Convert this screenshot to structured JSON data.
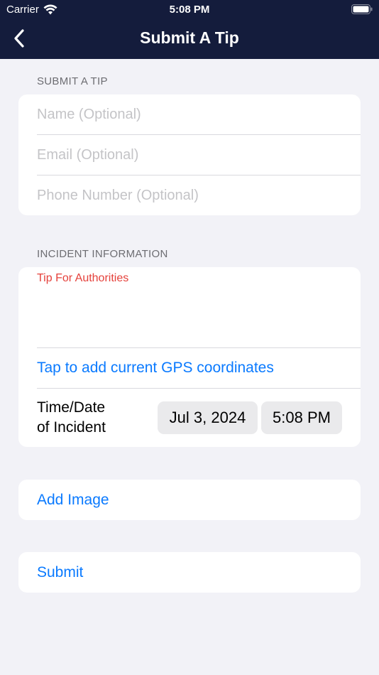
{
  "status_bar": {
    "carrier": "Carrier",
    "time": "5:08 PM"
  },
  "nav": {
    "title": "Submit A Tip",
    "back_icon": "chevron-left-icon"
  },
  "contact_section": {
    "header": "SUBMIT A TIP",
    "name_placeholder": "Name (Optional)",
    "email_placeholder": "Email (Optional)",
    "phone_placeholder": "Phone Number (Optional)"
  },
  "incident_section": {
    "header": "INCIDENT INFORMATION",
    "tip_label": "Tip For Authorities",
    "gps_link": "Tap to add current GPS coordinates",
    "datetime_label_line1": "Time/Date",
    "datetime_label_line2": "of Incident",
    "date_value": "Jul 3, 2024",
    "time_value": "5:08 PM"
  },
  "actions": {
    "add_image": "Add Image",
    "submit": "Submit"
  },
  "colors": {
    "nav_bg": "#141c3c",
    "accent": "#0a7aff",
    "tip_label": "#e5413b",
    "background": "#f2f2f7"
  }
}
